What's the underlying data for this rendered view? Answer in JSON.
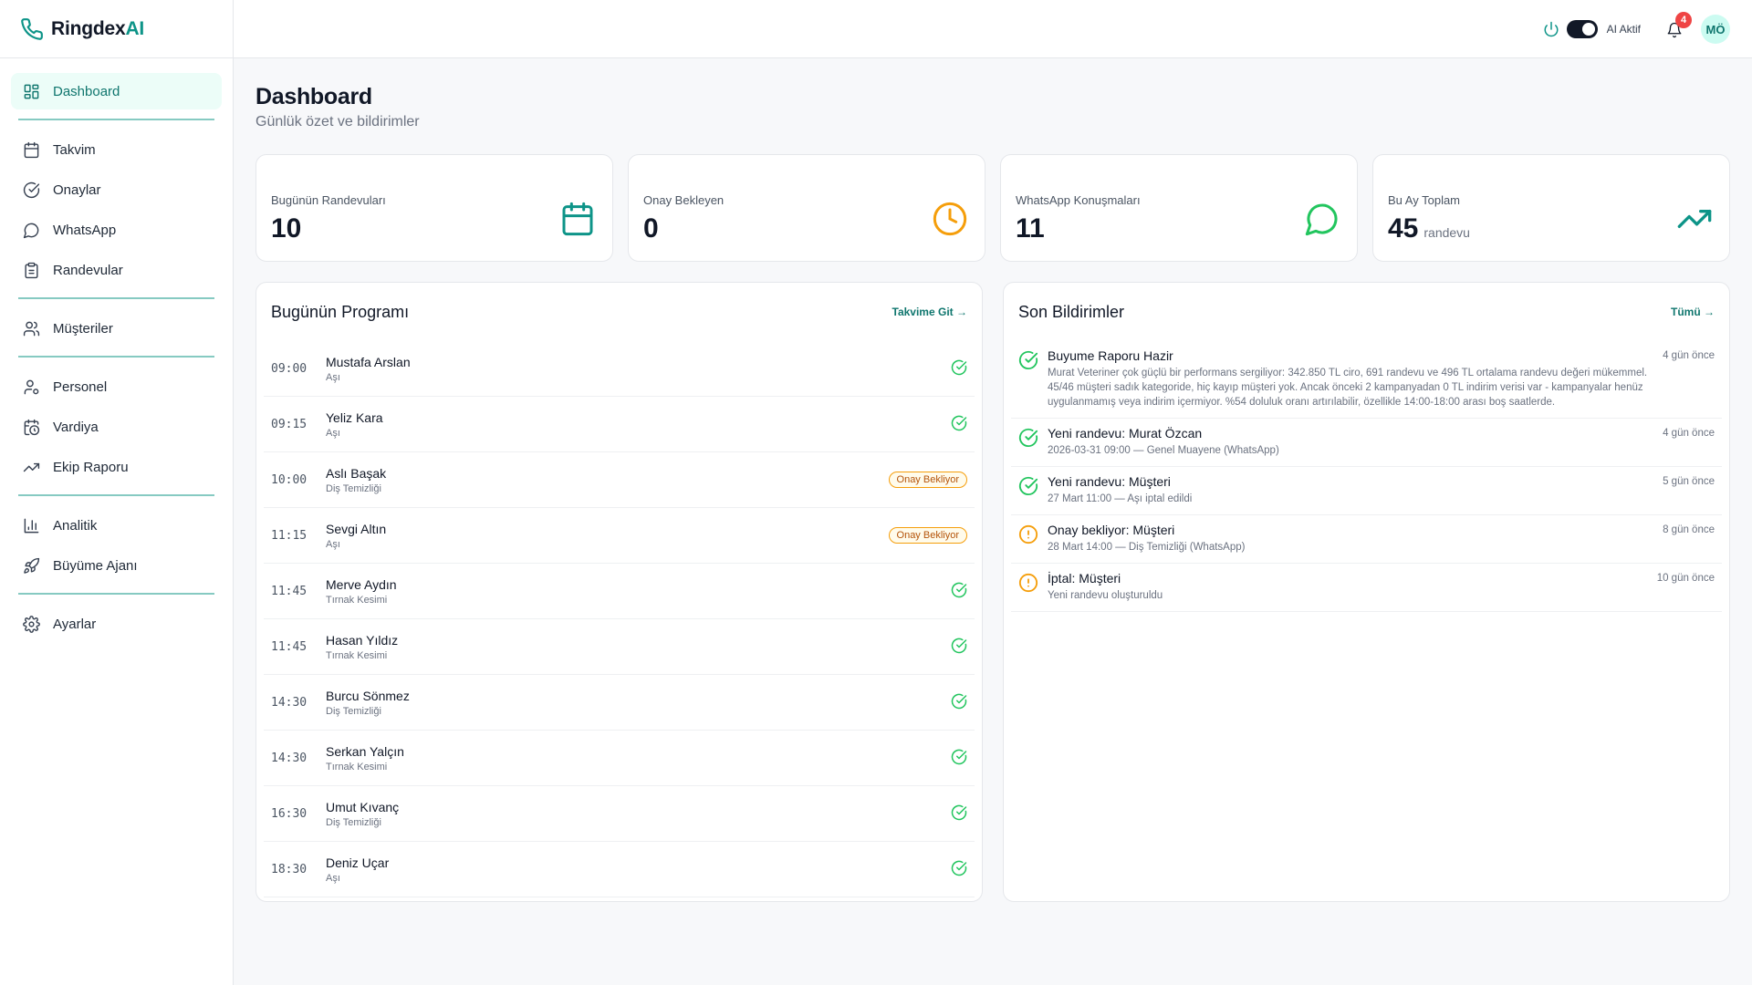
{
  "brand": {
    "name": "Ringdex",
    "suffix": "AI"
  },
  "sidebar": {
    "items": [
      {
        "label": "Dashboard"
      },
      {
        "label": "Takvim"
      },
      {
        "label": "Onaylar"
      },
      {
        "label": "WhatsApp"
      },
      {
        "label": "Randevular"
      },
      {
        "label": "Müşteriler"
      },
      {
        "label": "Personel"
      },
      {
        "label": "Vardiya"
      },
      {
        "label": "Ekip Raporu"
      },
      {
        "label": "Analitik"
      },
      {
        "label": "Büyüme Ajanı"
      },
      {
        "label": "Ayarlar"
      }
    ]
  },
  "topbar": {
    "ai_label": "AI Aktif",
    "notification_count": "4",
    "avatar_initials": "MÖ"
  },
  "header": {
    "title": "Dashboard",
    "subtitle": "Günlük özet ve bildirimler"
  },
  "stats": [
    {
      "label": "Bugünün Randevuları",
      "value": "10",
      "icon": "calendar-icon",
      "color": "#0d9488"
    },
    {
      "label": "Onay Bekleyen",
      "value": "0",
      "icon": "clock-icon",
      "color": "#f59e0b"
    },
    {
      "label": "WhatsApp Konuşmaları",
      "value": "11",
      "icon": "chat-bubble-icon",
      "color": "#22c55e"
    },
    {
      "label": "Bu Ay Toplam",
      "value": "45",
      "unit": "randevu",
      "icon": "trending-up-icon",
      "color": "#0d9488"
    }
  ],
  "schedule": {
    "title": "Bugünün Programı",
    "link": "Takvime Git →",
    "rows": [
      {
        "time": "09:00",
        "name": "Mustafa Arslan",
        "service": "Aşı",
        "status": "confirmed"
      },
      {
        "time": "09:15",
        "name": "Yeliz Kara",
        "service": "Aşı",
        "status": "confirmed"
      },
      {
        "time": "10:00",
        "name": "Aslı Başak",
        "service": "Diş Temizliği",
        "status": "pending",
        "status_label": "Onay Bekliyor"
      },
      {
        "time": "11:15",
        "name": "Sevgi Altın",
        "service": "Aşı",
        "status": "pending",
        "status_label": "Onay Bekliyor"
      },
      {
        "time": "11:45",
        "name": "Merve Aydın",
        "service": "Tırnak Kesimi",
        "status": "confirmed"
      },
      {
        "time": "11:45",
        "name": "Hasan Yıldız",
        "service": "Tırnak Kesimi",
        "status": "confirmed"
      },
      {
        "time": "14:30",
        "name": "Burcu Sönmez",
        "service": "Diş Temizliği",
        "status": "confirmed"
      },
      {
        "time": "14:30",
        "name": "Serkan Yalçın",
        "service": "Tırnak Kesimi",
        "status": "confirmed"
      },
      {
        "time": "16:30",
        "name": "Umut Kıvanç",
        "service": "Diş Temizliği",
        "status": "confirmed"
      },
      {
        "time": "18:30",
        "name": "Deniz Uçar",
        "service": "Aşı",
        "status": "confirmed"
      }
    ]
  },
  "notifications": {
    "title": "Son Bildirimler",
    "link": "Tümü →",
    "items": [
      {
        "title": "Buyume Raporu Hazir",
        "text": "Murat Veteriner çok güçlü bir performans sergiliyor: 342.850 TL ciro, 691 randevu ve 496 TL ortalama randevu değeri mükemmel. 45/46 müşteri sadık kategoride, hiç kayıp müşteri yok. Ancak önceki 2 kampanyadan 0 TL indirim verisi var - kampanyalar henüz uygulanmamış veya indirim içermiyor. %54 doluluk oranı artırılabilir, özellikle 14:00-18:00 arası boş saatlerde.",
        "time": "4 gün önce",
        "kind": "success"
      },
      {
        "title": "Yeni randevu: Murat Özcan",
        "text": "2026-03-31 09:00 — Genel Muayene (WhatsApp)",
        "time": "4 gün önce",
        "kind": "success"
      },
      {
        "title": "Yeni randevu: Müşteri",
        "text": "27 Mart 11:00 — Aşı iptal edildi",
        "time": "5 gün önce",
        "kind": "success"
      },
      {
        "title": "Onay bekliyor: Müşteri",
        "text": "28 Mart 14:00 — Diş Temizliği (WhatsApp)",
        "time": "8 gün önce",
        "kind": "warning"
      },
      {
        "title": "İptal: Müşteri",
        "text": "Yeni randevu oluşturuldu",
        "time": "10 gün önce",
        "kind": "warning"
      }
    ]
  }
}
